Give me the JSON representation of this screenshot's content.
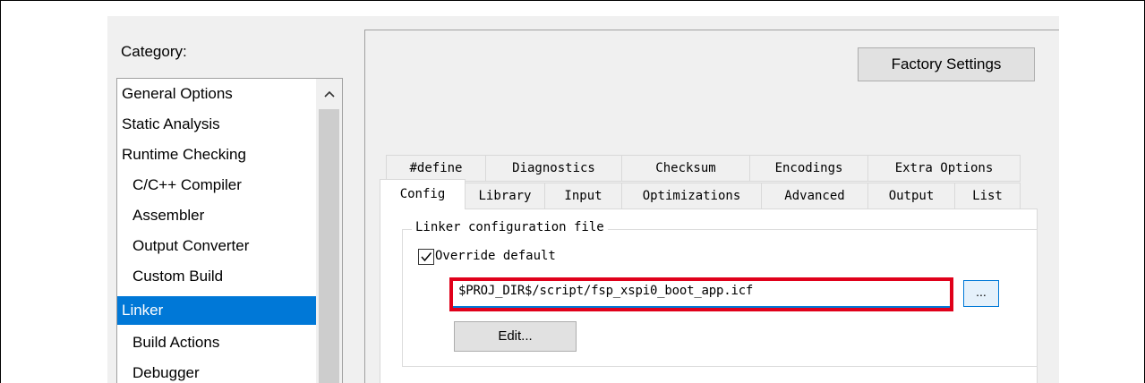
{
  "category": {
    "label": "Category:",
    "items": [
      {
        "label": "General Options",
        "selected": false
      },
      {
        "label": "Static Analysis",
        "selected": false
      },
      {
        "label": "Runtime Checking",
        "selected": false
      },
      {
        "label": "C/C++ Compiler",
        "selected": false
      },
      {
        "label": "Assembler",
        "selected": false
      },
      {
        "label": "Output Converter",
        "selected": false
      },
      {
        "label": "Custom Build",
        "selected": false
      },
      {
        "label": "Linker",
        "selected": true
      },
      {
        "label": "Build Actions",
        "selected": false
      },
      {
        "label": "Debugger",
        "selected": false
      }
    ],
    "scroll_up_icon": "chevron-up-icon"
  },
  "factory_settings_label": "Factory Settings",
  "tabs": {
    "row_back": [
      "#define",
      "Diagnostics",
      "Checksum",
      "Encodings",
      "Extra Options"
    ],
    "row_front": [
      "Config",
      "Library",
      "Input",
      "Optimizations",
      "Advanced",
      "Output",
      "List"
    ],
    "active": "Config"
  },
  "linker_config": {
    "group_title": "Linker configuration file",
    "override_label": "Override default",
    "override_checked": true,
    "path_value": "$PROJ_DIR$/script/fsp_xspi0_boot_app.icf",
    "browse_label": "...",
    "edit_label": "Edit..."
  },
  "colors": {
    "selection": "#0078d7",
    "highlight_border": "#e0001a"
  }
}
